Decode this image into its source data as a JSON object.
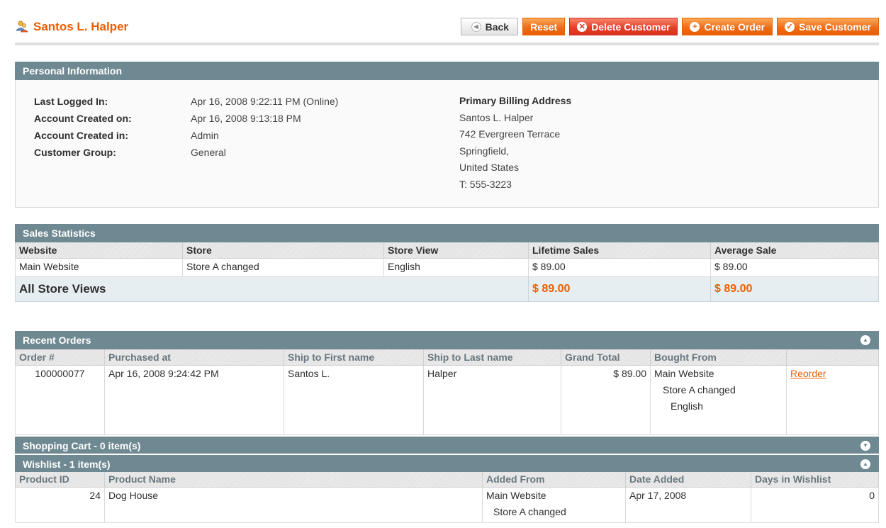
{
  "header": {
    "title": "Santos L. Halper",
    "buttons": {
      "back": "Back",
      "reset": "Reset",
      "delete": "Delete Customer",
      "create_order": "Create Order",
      "save": "Save Customer"
    }
  },
  "personal": {
    "heading": "Personal Information",
    "rows": [
      {
        "label": "Last Logged In:",
        "value": "Apr 16, 2008 9:22:11 PM (Online)"
      },
      {
        "label": "Account Created on:",
        "value": "Apr 16, 2008 9:13:18 PM"
      },
      {
        "label": "Account Created in:",
        "value": "Admin"
      },
      {
        "label": "Customer Group:",
        "value": "General"
      }
    ],
    "address": {
      "title": "Primary Billing Address",
      "lines": [
        "Santos L. Halper",
        "742 Evergreen Terrace",
        "Springfield,",
        "United States",
        "T: 555-3223"
      ]
    }
  },
  "sales": {
    "heading": "Sales Statistics",
    "columns": [
      "Website",
      "Store",
      "Store View",
      "Lifetime Sales",
      "Average Sale"
    ],
    "row": [
      "Main Website",
      "Store A changed",
      "English",
      "$ 89.00",
      "$ 89.00"
    ],
    "total": {
      "label": "All Store Views",
      "lifetime": "$ 89.00",
      "average": "$ 89.00"
    }
  },
  "recent_orders": {
    "heading": "Recent Orders",
    "columns": [
      "Order #",
      "Purchased at",
      "Ship to First name",
      "Ship to Last name",
      "Grand Total",
      "Bought From",
      ""
    ],
    "row": {
      "order": "100000077",
      "purchased": "Apr 16, 2008 9:24:42 PM",
      "first": "Santos L.",
      "last": "Halper",
      "total": "$ 89.00",
      "bought_from": [
        "Main Website",
        "Store A changed",
        "English"
      ],
      "action": "Reorder"
    }
  },
  "cart": {
    "heading": "Shopping Cart - 0 item(s)"
  },
  "wishlist": {
    "heading": "Wishlist - 1 item(s)",
    "columns": [
      "Product ID",
      "Product Name",
      "Added From",
      "Date Added",
      "Days in Wishlist"
    ],
    "row": {
      "id": "24",
      "name": "Dog House",
      "added_from": [
        "Main Website",
        "Store A changed"
      ],
      "date": "Apr 17, 2008",
      "days": "0"
    }
  },
  "colors": {
    "accent": "#eb5e00",
    "section_head": "#6f8992",
    "total_bg": "#e7eef2"
  }
}
